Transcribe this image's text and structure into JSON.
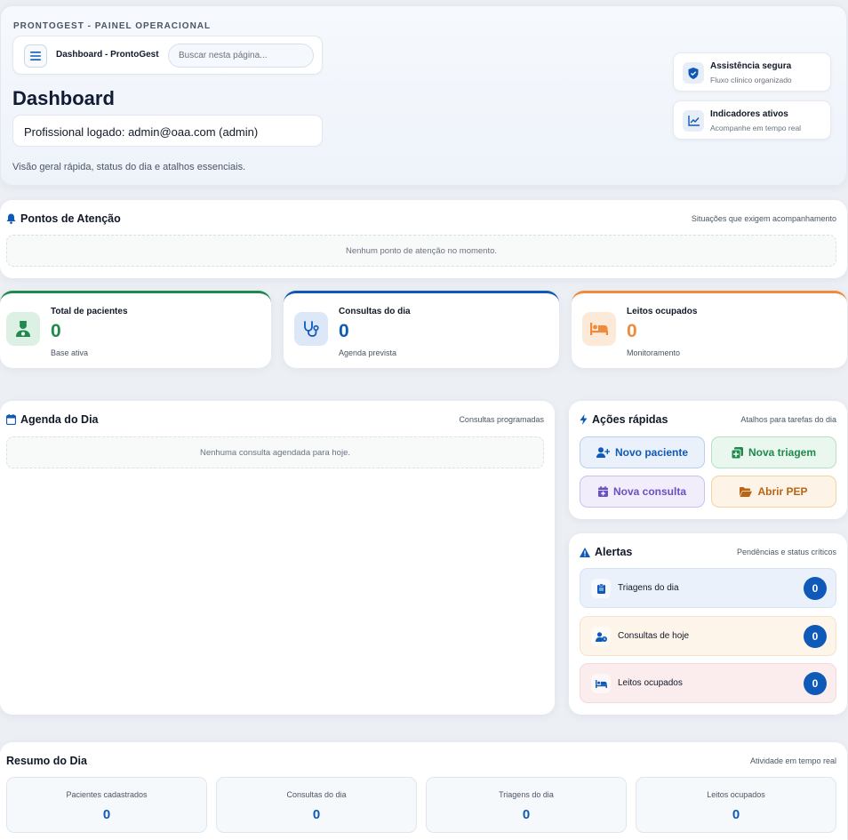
{
  "header": {
    "kicker": "PRONTOGEST - PAINEL OPERACIONAL",
    "topbar_title": "Dashboard - ProntoGest",
    "search_placeholder": "Buscar nesta página...",
    "page_title": "Dashboard",
    "user_text": "Profissional logado: admin@oaa.com (admin)",
    "subtitle": "Visão geral rápida, status do dia e atalhos essenciais.",
    "info_cards": [
      {
        "title": "Assistência segura",
        "sub": "Fluxo clínico organizado",
        "icon": "shield-icon"
      },
      {
        "title": "Indicadores ativos",
        "sub": "Acompanhe em tempo real",
        "icon": "chart-line-icon"
      }
    ]
  },
  "attention": {
    "title": "Pontos de Atenção",
    "note": "Situações que exigem acompanhamento",
    "empty": "Nenhum ponto de atenção no momento."
  },
  "stats": [
    {
      "label": "Total de pacientes",
      "value": "0",
      "sub": "Base ativa",
      "icon": "user-nurse-icon",
      "color": "#1f8a4c"
    },
    {
      "label": "Consultas do dia",
      "value": "0",
      "sub": "Agenda prevista",
      "icon": "stethoscope-icon",
      "color": "#0f5ab8"
    },
    {
      "label": "Leitos ocupados",
      "value": "0",
      "sub": "Monitoramento",
      "icon": "bed-icon",
      "color": "#f08a3c"
    }
  ],
  "agenda": {
    "title": "Agenda do Dia",
    "note": "Consultas programadas",
    "empty": "Nenhuma consulta agendada para hoje."
  },
  "quick_actions": {
    "title": "Ações rápidas",
    "note": "Atalhos para tarefas do dia",
    "buttons": [
      {
        "label": "Novo paciente",
        "icon": "user-plus-icon"
      },
      {
        "label": "Nova triagem",
        "icon": "notes-medical-icon"
      },
      {
        "label": "Nova consulta",
        "icon": "calendar-plus-icon"
      },
      {
        "label": "Abrir PEP",
        "icon": "folder-open-icon"
      }
    ]
  },
  "alerts": {
    "title": "Alertas",
    "note": "Pendências e status críticos",
    "items": [
      {
        "label": "Triagens do dia",
        "count": "0",
        "icon": "clipboard-icon"
      },
      {
        "label": "Consultas de hoje",
        "count": "0",
        "icon": "user-clock-icon"
      },
      {
        "label": "Leitos ocupados",
        "count": "0",
        "icon": "bed-icon"
      }
    ]
  },
  "summary": {
    "title": "Resumo do Dia",
    "note": "Atividade em tempo real",
    "items": [
      {
        "label": "Pacientes cadastrados",
        "value": "0"
      },
      {
        "label": "Consultas do dia",
        "value": "0"
      },
      {
        "label": "Triagens do dia",
        "value": "0"
      },
      {
        "label": "Leitos ocupados",
        "value": "0"
      }
    ]
  },
  "colors": {
    "primary": "#0f5ab8",
    "green": "#1f8a4c",
    "orange": "#f08a3c",
    "purple": "#6b4fc4"
  }
}
